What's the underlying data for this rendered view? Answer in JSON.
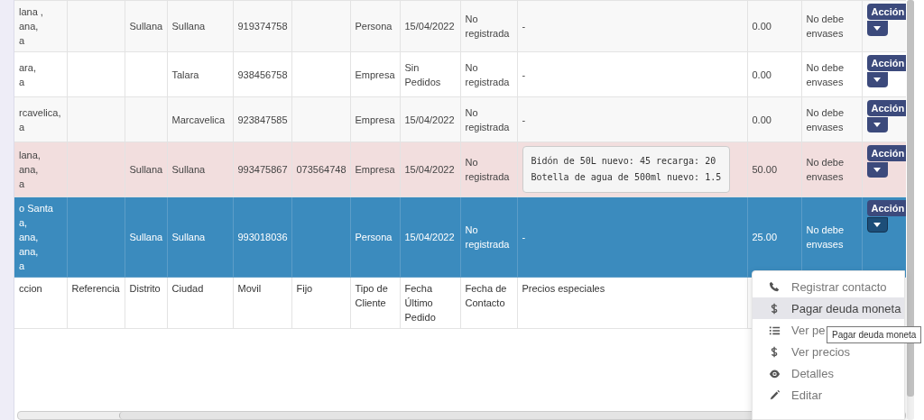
{
  "table": {
    "columns": [
      "ccion",
      "Referencia",
      "Distrito",
      "Ciudad",
      "Movil",
      "Fijo",
      "Tipo de Cliente",
      "Fecha Último Pedido",
      "Fecha de Contacto",
      "Precios especiales"
    ],
    "rows": [
      {
        "address": "lana ,\nana,\na",
        "distrito": "Sullana",
        "ciudad": "Sullana",
        "movil": "919374758",
        "fijo": "",
        "tipo": "Persona",
        "fecha_ultimo": "15/04/2022",
        "fecha_contacto": "No registrada",
        "precios": "-",
        "deuda": "0.00",
        "envases": "No debe envases",
        "action": "Acción",
        "highlighted": false,
        "selected": false,
        "menu_open": false
      },
      {
        "address": "ara,\na",
        "distrito": "",
        "ciudad": "Talara",
        "movil": "938456758",
        "fijo": "",
        "tipo": "Empresa",
        "fecha_ultimo": "Sin Pedidos",
        "fecha_contacto": "No registrada",
        "precios": "-",
        "deuda": "0.00",
        "envases": "No debe envases",
        "action": "Acción",
        "highlighted": false,
        "selected": false,
        "menu_open": false
      },
      {
        "address": "rcavelica,\na",
        "distrito": "",
        "ciudad": "Marcavelica",
        "movil": "923847585",
        "fijo": "",
        "tipo": "Empresa",
        "fecha_ultimo": "15/04/2022",
        "fecha_contacto": "No registrada",
        "precios": "-",
        "deuda": "0.00",
        "envases": "No debe envases",
        "action": "Acción",
        "highlighted": false,
        "selected": false,
        "menu_open": false
      },
      {
        "address": "lana,\nana,\na",
        "distrito": "Sullana",
        "ciudad": "Sullana",
        "movil": "993475867",
        "fijo": "073564748",
        "tipo": "Empresa",
        "fecha_ultimo": "15/04/2022",
        "fecha_contacto": "No registrada",
        "special_prices": [
          "Bidón de 50L nuevo: 45 recarga: 20",
          "Botella de agua de 500ml nuevo: 1.5"
        ],
        "deuda": "50.00",
        "envases": "No debe envases",
        "action": "Acción",
        "highlighted": true,
        "selected": false,
        "menu_open": false
      },
      {
        "address": "o Santa\na,\nana,\nana,\na",
        "distrito": "Sullana",
        "ciudad": "Sullana",
        "movil": "993018036",
        "fijo": "",
        "tipo": "Persona",
        "fecha_ultimo": "15/04/2022",
        "fecha_contacto": "No registrada",
        "precios": "-",
        "deuda": "25.00",
        "envases": "No debe envases",
        "action": "Acción",
        "highlighted": false,
        "selected": true,
        "menu_open": true
      }
    ]
  },
  "action_menu": {
    "items": [
      {
        "kind": "phone",
        "label": "Registrar contacto",
        "selected": false
      },
      {
        "kind": "dollar",
        "label": "Pagar deuda moneta",
        "selected": true
      },
      {
        "kind": "list",
        "label": "Ver pe",
        "selected": false
      },
      {
        "kind": "dollar",
        "label": "Ver precios",
        "selected": false
      },
      {
        "kind": "eye",
        "label": "Detalles",
        "selected": false
      },
      {
        "kind": "pencil",
        "label": "Editar",
        "selected": false
      }
    ]
  },
  "tooltip": {
    "text": "Pagar deuda moneta"
  }
}
